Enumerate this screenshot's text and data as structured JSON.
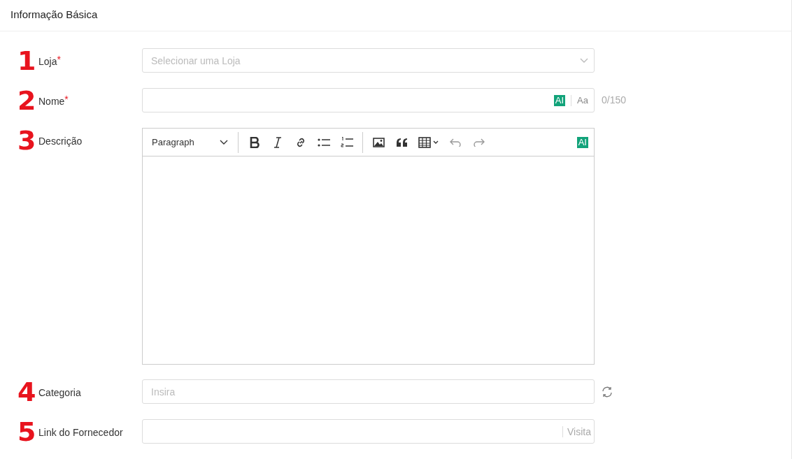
{
  "section": {
    "title": "Informação Básica"
  },
  "fields": [
    {
      "kind": "select",
      "number": "1",
      "label": "Loja",
      "required_mark": "*",
      "placeholder": "Selecionar uma Loja"
    },
    {
      "kind": "text",
      "number": "2",
      "label": "Nome",
      "required_mark": "*",
      "ai_badge": "AI",
      "case_button": "Aa",
      "counter": "0/150"
    },
    {
      "kind": "editor",
      "number": "3",
      "label": "Descrição",
      "block_style": "Paragraph",
      "ai_badge": "AI"
    },
    {
      "kind": "refresh",
      "number": "4",
      "label": "Categoria",
      "placeholder": "Insira"
    },
    {
      "kind": "link",
      "number": "5",
      "label": "Link do Fornecedor",
      "action": "Visita"
    }
  ]
}
